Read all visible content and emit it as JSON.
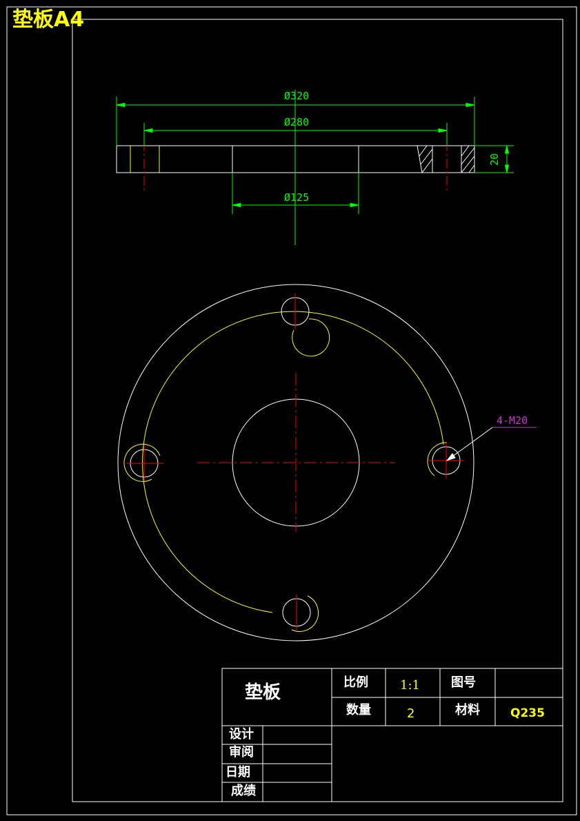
{
  "sheet_title": "垫板A4",
  "colors": {
    "outline": "#ffffff",
    "dimension": "#00ff00",
    "centerline": "#ff0000",
    "pitch_circle": "#ffff00",
    "callout": "#cc33cc",
    "title_text": "#ffff00"
  },
  "section_view": {
    "dimensions": {
      "outer_diameter": "Ø320",
      "pitch_diameter": "Ø280",
      "inner_diameter": "Ø125",
      "thickness": "20"
    }
  },
  "plan_view": {
    "hole_callout": "4-M20"
  },
  "title_block": {
    "part_name": "垫板",
    "scale_label": "比例",
    "scale_value": "1:1",
    "drawing_no_label": "图号",
    "drawing_no_value": "",
    "quantity_label": "数量",
    "quantity_value": "2",
    "material_label": "材料",
    "material_value": "Q235",
    "design_label": "设计",
    "review_label": "审阅",
    "date_label": "日期",
    "grade_label": "成绩"
  }
}
